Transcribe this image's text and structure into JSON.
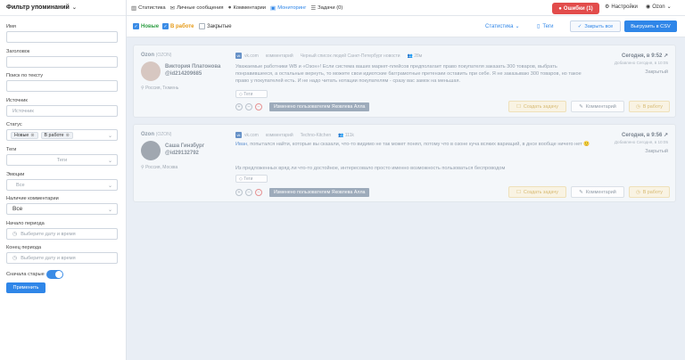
{
  "sidebar": {
    "title": "Фильтр упоминаний",
    "fields": [
      {
        "label": "Имя",
        "value": ""
      },
      {
        "label": "Заголовок",
        "value": ""
      },
      {
        "label": "Поиск по тексту",
        "value": ""
      },
      {
        "label": "Источник",
        "placeholder": "Источник"
      },
      {
        "label": "Статус",
        "chips": [
          "Новые",
          "В работе"
        ]
      },
      {
        "label": "Теги",
        "placeholder": "Теги"
      },
      {
        "label": "Эмоции",
        "placeholder": "Все"
      },
      {
        "label": "Наличие комментарии",
        "value": "Все"
      },
      {
        "label": "Начало периода",
        "placeholder": "Выберите дату и время"
      },
      {
        "label": "Конец периода",
        "placeholder": "Выберите дату и время"
      }
    ],
    "toggle_label": "Сначала старые",
    "toggle_on": true,
    "apply_label": "Применить"
  },
  "nav": {
    "items": [
      {
        "icon": "stats-icon",
        "label": "Статистика"
      },
      {
        "icon": "mail-icon",
        "label": "Личные сообщения"
      },
      {
        "icon": "comment-icon",
        "label": "Комментарии"
      },
      {
        "icon": "monitor-icon",
        "label": "Мониторинг",
        "active": true
      },
      {
        "icon": "tasks-icon",
        "label": "Задачи (0)"
      }
    ],
    "errors_label": "Ошибки (1)",
    "settings_label": "Настройки",
    "user_label": "Ozon"
  },
  "toolbar": {
    "filters": [
      {
        "label": "Новые",
        "checked": true,
        "color": "#2f9e44"
      },
      {
        "label": "В работе",
        "checked": true,
        "color": "#e69a17"
      },
      {
        "label": "Закрытые",
        "checked": false,
        "color": "#333333"
      }
    ],
    "stats_label": "Статистика",
    "tags_label": "Теги",
    "close_all_label": "Закрыть все",
    "export_label": "Выгрузить в CSV"
  },
  "mentions": [
    {
      "source_name": "Ozon",
      "source_count": "(OZON)",
      "author_name": "Виктория Платонова",
      "author_id": "@id214209685",
      "location": "Россия, Тюмень",
      "platform": "vk.com",
      "type": "комментарий",
      "group": "Черный список людей Санкт-Петербург новости",
      "audience": "28м",
      "text": "Уважаемые работники WB и «Озон»! Если система ваших маркет-плейсов предполагает право покупателя заказать 300 товаров, выбрать понравившееся, а остальные вернуть, то можете свои идиотские багграмотные претензии оставить при себе. Я не заказываю 300 товаров, но такое право у покупателей есть. И не надо читать нотации покупателям - сразу вас замок на меньшая.",
      "highlight": "",
      "tags_label": "Теги",
      "changed_by": "Изменено пользователем Яковлева Алла",
      "date": "Сегодня, в 9:52",
      "added": "Добавлено Сегодня, в 10:05",
      "status": "Закрытый",
      "task_label": "Создать задачу",
      "comment_label": "Комментарий",
      "work_label": "В работу"
    },
    {
      "source_name": "Ozon",
      "source_count": "(OZON)",
      "author_name": "Саша Гинзбург",
      "author_id": "@id29132792",
      "location": "Россия, Москва",
      "platform": "vk.com",
      "type": "комментарий",
      "group": "Techno-Kitchen",
      "audience": "111k",
      "text": ", попытался найти, которые вы сказали, что-то видимо не так может понял, потому что в озоне куча всяких вариаций, в днсе вообще ничего нет 🙂",
      "highlight": "Иван",
      "text2": "Из предложенных вряд ли что-то достойное, интересовало просто именно возможность пользоваться беспроводом",
      "tags_label": "Теги",
      "changed_by": "Изменено пользователем Яковлева Алла",
      "date": "Сегодня, в 9:56",
      "added": "Добавлено Сегодня, в 10:05",
      "status": "Закрытый",
      "task_label": "Создать задачу",
      "comment_label": "Комментарий",
      "work_label": "В работу"
    }
  ]
}
